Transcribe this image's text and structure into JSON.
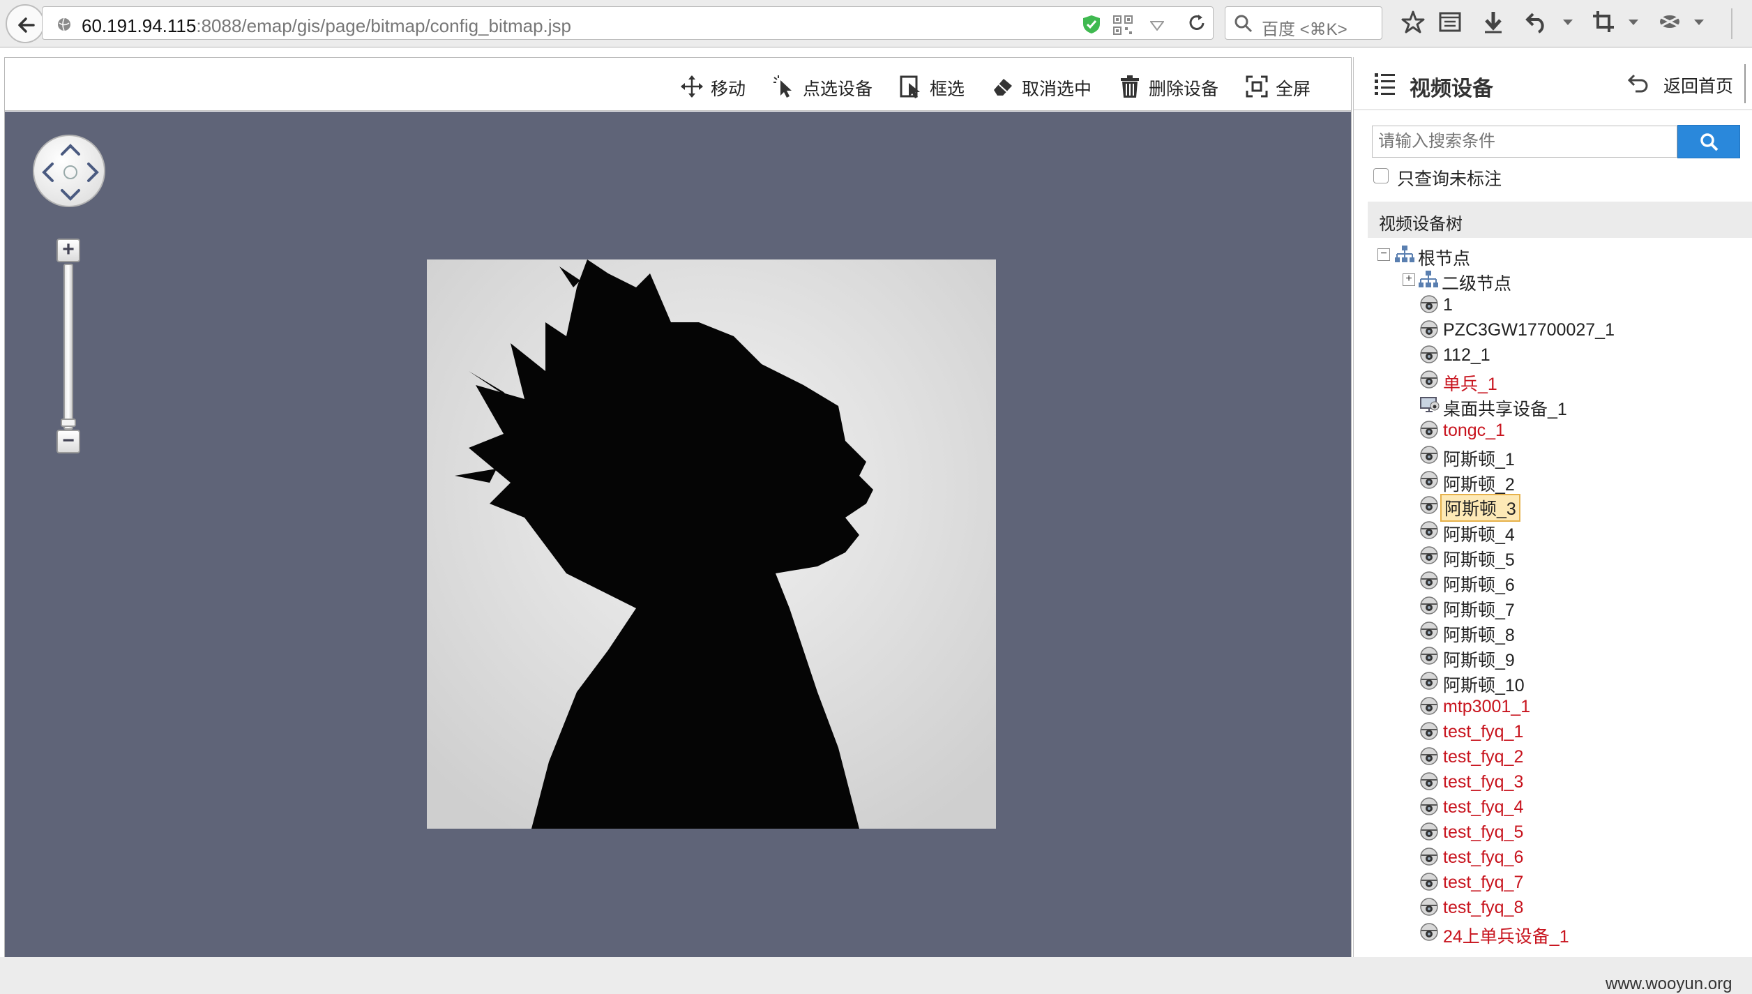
{
  "browser": {
    "url_host": "60.191.94.115",
    "url_rest": ":8088/emap/gis/page/bitmap/config_bitmap.jsp",
    "search_placeholder": "百度 <⌘K>"
  },
  "toolbar": {
    "move": "移动",
    "point_select": "点选设备",
    "box_select": "框选",
    "cancel_select": "取消选中",
    "delete_device": "删除设备",
    "fullscreen": "全屏"
  },
  "panel": {
    "title": "视频设备",
    "home": "返回首页",
    "search_placeholder": "请输入搜索条件",
    "only_unmarked": "只查询未标注",
    "tree_title": "视频设备树"
  },
  "tree": {
    "root": "根节点",
    "level2": "二级节点",
    "devices": [
      {
        "label": "1",
        "red": false,
        "icon": "camera-icon"
      },
      {
        "label": "PZC3GW17700027_1",
        "red": false,
        "icon": "camera-icon"
      },
      {
        "label": "112_1",
        "red": false,
        "icon": "camera-icon"
      },
      {
        "label": "单兵_1",
        "red": true,
        "icon": "camera-icon"
      },
      {
        "label": "桌面共享设备_1",
        "red": false,
        "icon": "desktop-camera-icon"
      },
      {
        "label": "tongc_1",
        "red": true,
        "icon": "camera-icon"
      },
      {
        "label": "阿斯顿_1",
        "red": false,
        "icon": "camera-icon"
      },
      {
        "label": "阿斯顿_2",
        "red": false,
        "icon": "camera-icon"
      },
      {
        "label": "阿斯顿_3",
        "red": false,
        "icon": "camera-icon",
        "selected": true
      },
      {
        "label": "阿斯顿_4",
        "red": false,
        "icon": "camera-icon"
      },
      {
        "label": "阿斯顿_5",
        "red": false,
        "icon": "camera-icon"
      },
      {
        "label": "阿斯顿_6",
        "red": false,
        "icon": "camera-icon"
      },
      {
        "label": "阿斯顿_7",
        "red": false,
        "icon": "camera-icon"
      },
      {
        "label": "阿斯顿_8",
        "red": false,
        "icon": "camera-icon"
      },
      {
        "label": "阿斯顿_9",
        "red": false,
        "icon": "camera-icon"
      },
      {
        "label": "阿斯顿_10",
        "red": false,
        "icon": "camera-icon"
      },
      {
        "label": "mtp3001_1",
        "red": true,
        "icon": "camera-icon"
      },
      {
        "label": "test_fyq_1",
        "red": true,
        "icon": "camera-icon"
      },
      {
        "label": "test_fyq_2",
        "red": true,
        "icon": "camera-icon"
      },
      {
        "label": "test_fyq_3",
        "red": true,
        "icon": "camera-icon"
      },
      {
        "label": "test_fyq_4",
        "red": true,
        "icon": "camera-icon"
      },
      {
        "label": "test_fyq_5",
        "red": true,
        "icon": "camera-icon"
      },
      {
        "label": "test_fyq_6",
        "red": true,
        "icon": "camera-icon"
      },
      {
        "label": "test_fyq_7",
        "red": true,
        "icon": "camera-icon"
      },
      {
        "label": "test_fyq_8",
        "red": true,
        "icon": "camera-icon"
      },
      {
        "label": "24上单兵设备_1",
        "red": true,
        "icon": "camera-icon"
      }
    ]
  },
  "colors": {
    "map_background": "#5f6478",
    "accent_blue": "#2a88db",
    "unmarked_red": "#c8141e",
    "selection_bg": "#fde9b6"
  },
  "watermark": "www.wooyun.org"
}
